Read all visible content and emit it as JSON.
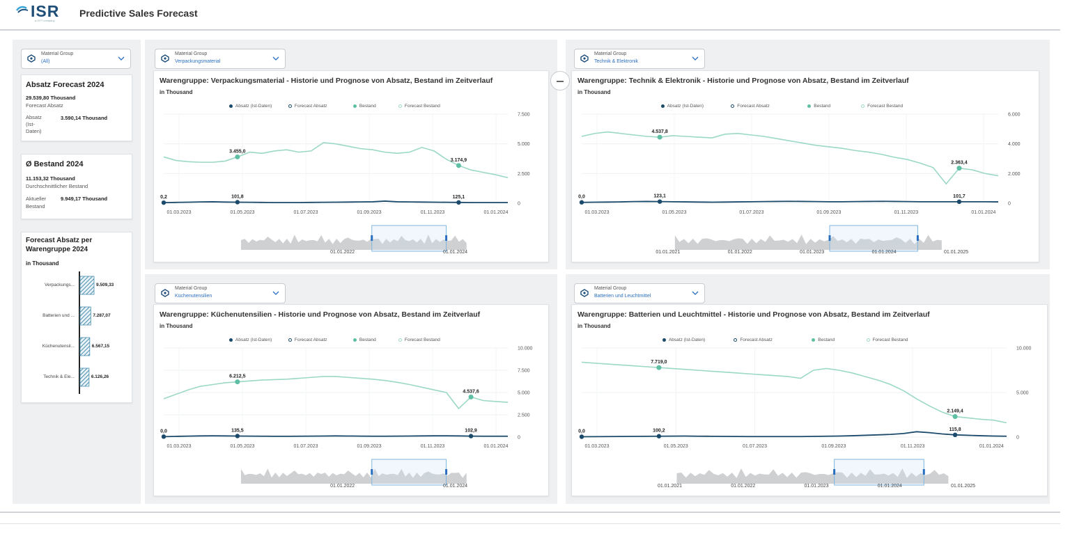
{
  "header": {
    "logo_text": "ISR",
    "logo_sub": "a GFT company",
    "title": "Predictive Sales Forecast"
  },
  "sidebar": {
    "filter": {
      "label": "Material Group",
      "value": "(All)"
    },
    "kpi1": {
      "title": "Absatz Forecast 2024",
      "value1": "29.539,80 Thousand",
      "label1": "Forecast Absatz",
      "label2a": "Absatz",
      "label2b": "(Ist-",
      "label2c": "Daten)",
      "value2": "3.590,14 Thousand"
    },
    "kpi2": {
      "title": "Ø Bestand  2024",
      "value1": "11.153,32 Thousand",
      "label1": "Durchschnittlicher Bestand",
      "label2a": "Aktueller",
      "label2b": "Bestand",
      "value2": "9.949,17 Thousand"
    },
    "bar_chart": {
      "title1": "Forecast Absatz per",
      "title2": "Warengruppe 2024",
      "subtitle": "in Thousand",
      "color": "#4a8fb0",
      "items": [
        {
          "label": "Verpackungs...",
          "value": 9509.33,
          "value_label": "9.509,33"
        },
        {
          "label": "Batterien und ...",
          "value": 7287.07,
          "value_label": "7.287,07"
        },
        {
          "label": "Küchenutensil...",
          "value": 6567.15,
          "value_label": "6.567,15"
        },
        {
          "label": "Technik & Ele...",
          "value": 6126.26,
          "value_label": "6.126,26"
        }
      ]
    }
  },
  "legend": {
    "absatz": "Absatz (Ist-Daten)",
    "forecast_absatz": "Forecast Absatz",
    "bestand": "Bestand",
    "forecast_bestand": "Forecast Bestand"
  },
  "colors": {
    "absatz": "#1b4a6b",
    "bestand": "#9bd8c7",
    "bestand_dot": "#5fbfa4",
    "range": "#cfd0d2",
    "accent": "#2a6fbf"
  },
  "subtitle": "in Thousand",
  "filter_label": "Material Group",
  "chart_data": [
    {
      "type": "line",
      "filter_value": "Verpackungsmaterial",
      "title": "Warengruppe: Verpackungsmaterial - Historie und Prognose von Absatz, Bestand im Zeitverlauf",
      "x_ticks": [
        "01.03.2023",
        "01.05.2023",
        "01.07.2023",
        "01.09.2023",
        "01.11.2023",
        "01.01.2024"
      ],
      "y_ticks": [
        "7.500",
        "5.000",
        "2.500",
        "0"
      ],
      "ylim": [
        0,
        7500
      ],
      "bestand": [
        3900,
        3600,
        3500,
        3450,
        3450,
        3550,
        3900,
        4300,
        4200,
        4400,
        4500,
        4300,
        4400,
        5100,
        5000,
        4800,
        4600,
        4500,
        4300,
        4200,
        4300,
        4700,
        4400,
        3700,
        3175,
        2800,
        2600,
        2400,
        2150
      ],
      "absatz": [
        50,
        70,
        90,
        110,
        120,
        100,
        90,
        80,
        70,
        60,
        60,
        60,
        70,
        80,
        90,
        100,
        110,
        120,
        180,
        120,
        110,
        100,
        90,
        80,
        70,
        60,
        60,
        60,
        60
      ],
      "labels": [
        {
          "i": 6,
          "series": "bestand",
          "text": "3.455,0"
        },
        {
          "i": 24,
          "series": "bestand",
          "text": "3.174,9"
        },
        {
          "i": 0,
          "series": "absatz",
          "text": "0,2"
        },
        {
          "i": 6,
          "series": "absatz",
          "text": "101,8"
        },
        {
          "i": 24,
          "series": "absatz",
          "text": "125,1"
        }
      ],
      "range_ticks": [
        "01.01.2022",
        "01.01.2024"
      ]
    },
    {
      "type": "line",
      "filter_value": "Technik & Elektronik",
      "title": "Warengruppe: Technik & Elektronik - Historie und Prognose von Absatz, Bestand im Zeitverlauf",
      "x_ticks": [
        "01.03.2023",
        "01.05.2023",
        "01.07.2023",
        "01.09.2023",
        "01.11.2023",
        "01.01.2024"
      ],
      "y_ticks": [
        "6.000",
        "4.000",
        "2.000",
        "0"
      ],
      "ylim": [
        0,
        6000
      ],
      "bestand": [
        4500,
        4700,
        4800,
        4700,
        4600,
        4500,
        4450,
        4550,
        4500,
        4450,
        4400,
        4650,
        4700,
        4600,
        4500,
        4350,
        4200,
        4050,
        3900,
        3800,
        3700,
        3550,
        3450,
        3300,
        3100,
        2950,
        2700,
        2400,
        1300,
        2360,
        2250,
        2000,
        1850
      ],
      "absatz": [
        60,
        70,
        80,
        90,
        110,
        120,
        110,
        100,
        90,
        80,
        70,
        80,
        90,
        100,
        110,
        120,
        130,
        120,
        110,
        100,
        100,
        110,
        120,
        130,
        120,
        110,
        100,
        100,
        100,
        100,
        100,
        100,
        90
      ],
      "labels": [
        {
          "i": 6,
          "series": "bestand",
          "text": "4.537,8"
        },
        {
          "i": 29,
          "series": "bestand",
          "text": "2.363,4"
        },
        {
          "i": 0,
          "series": "absatz",
          "text": "0,0"
        },
        {
          "i": 6,
          "series": "absatz",
          "text": "123,1"
        },
        {
          "i": 29,
          "series": "absatz",
          "text": "101,7"
        }
      ],
      "range_ticks": [
        "01.01.2021",
        "01.01.2022",
        "01.01.2023",
        "01.01.2024",
        "01.01.2025"
      ]
    },
    {
      "type": "line",
      "filter_value": "Küchenutensilien",
      "title": "Warengruppe: Küchenutensilien - Historie und Prognose von Absatz, Bestand im Zeitverlauf",
      "x_ticks": [
        "01.03.2023",
        "01.05.2023",
        "01.07.2023",
        "01.09.2023",
        "01.11.2023",
        "01.01.2024"
      ],
      "y_ticks": [
        "10.000",
        "7.500",
        "5.000",
        "2.500",
        "0"
      ],
      "ylim": [
        0,
        10000
      ],
      "bestand": [
        4300,
        4800,
        5300,
        5700,
        5900,
        6100,
        6200,
        6300,
        6400,
        6450,
        6500,
        6600,
        6700,
        6800,
        6800,
        6700,
        6600,
        6500,
        6350,
        6150,
        5900,
        5600,
        5300,
        5000,
        3200,
        4500,
        4100,
        4000,
        3900
      ],
      "absatz": [
        50,
        80,
        110,
        130,
        140,
        130,
        120,
        110,
        100,
        90,
        90,
        100,
        110,
        120,
        130,
        120,
        110,
        100,
        100,
        110,
        120,
        130,
        140,
        140,
        130,
        110,
        100,
        100,
        100
      ],
      "labels": [
        {
          "i": 6,
          "series": "bestand",
          "text": "6.212,5"
        },
        {
          "i": 25,
          "series": "bestand",
          "text": "4.537,6"
        },
        {
          "i": 0,
          "series": "absatz",
          "text": "0,0"
        },
        {
          "i": 6,
          "series": "absatz",
          "text": "135,5"
        },
        {
          "i": 25,
          "series": "absatz",
          "text": "102,9"
        }
      ],
      "range_ticks": [
        "01.01.2022",
        "01.01.2024"
      ]
    },
    {
      "type": "line",
      "filter_value": "Batterien und Leuchtmittel",
      "title": "Warengruppe: Batterien und Leuchtmittel - Historie und Prognose von Absatz, Bestand im Zeitverlauf",
      "x_ticks": [
        "01.03.2023",
        "01.05.2023",
        "01.07.2023",
        "01.09.2023",
        "01.11.2023",
        "01.01.2024"
      ],
      "y_ticks": [
        "10.000",
        "5.000",
        "0"
      ],
      "ylim": [
        0,
        10000
      ],
      "bestand": [
        8400,
        8300,
        8200,
        8100,
        8000,
        7900,
        7800,
        7700,
        7600,
        7500,
        7400,
        7300,
        7200,
        7100,
        7000,
        6900,
        6800,
        6600,
        7500,
        7700,
        7500,
        7200,
        6800,
        6400,
        5900,
        5200,
        4300,
        3500,
        2800,
        2300,
        2150,
        2000,
        1900,
        1600
      ],
      "absatz": [
        40,
        50,
        60,
        70,
        80,
        90,
        100,
        110,
        120,
        100,
        90,
        80,
        70,
        60,
        60,
        60,
        60,
        60,
        80,
        100,
        120,
        150,
        200,
        250,
        300,
        400,
        600,
        500,
        350,
        250,
        200,
        150,
        120,
        100
      ],
      "labels": [
        {
          "i": 6,
          "series": "bestand",
          "text": "7.719,0"
        },
        {
          "i": 29,
          "series": "bestand",
          "text": "2.149,4"
        },
        {
          "i": 0,
          "series": "absatz",
          "text": "0,0"
        },
        {
          "i": 6,
          "series": "absatz",
          "text": "100,2"
        },
        {
          "i": 29,
          "series": "absatz",
          "text": "115,8"
        }
      ],
      "range_ticks": [
        "01.01.2021",
        "01.01.2022",
        "01.01.2023",
        "01.01.2024",
        "01.01.2025"
      ]
    }
  ]
}
